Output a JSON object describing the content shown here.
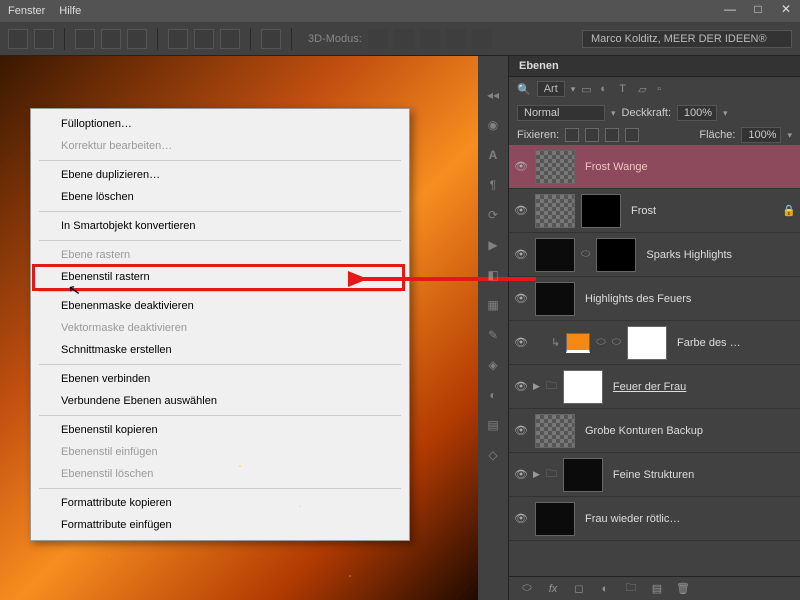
{
  "menubar": {
    "items": [
      "Fenster",
      "Hilfe"
    ]
  },
  "toolbar": {
    "mode_label": "3D-Modus:",
    "profile": "Marco Kolditz, MEER DER IDEEN®"
  },
  "context_menu": {
    "items": [
      {
        "label": "Fülloptionen…",
        "disabled": false
      },
      {
        "label": "Korrektur bearbeiten…",
        "disabled": true
      },
      {
        "sep": true
      },
      {
        "label": "Ebene duplizieren…",
        "disabled": false
      },
      {
        "label": "Ebene löschen",
        "disabled": false
      },
      {
        "sep": true
      },
      {
        "label": "In Smartobjekt konvertieren",
        "disabled": false
      },
      {
        "sep": true
      },
      {
        "label": "Ebene rastern",
        "disabled": true
      },
      {
        "label": "Ebenenstil rastern",
        "disabled": false
      },
      {
        "sep": true
      },
      {
        "label": "Ebenenmaske deaktivieren",
        "disabled": false
      },
      {
        "label": "Vektormaske deaktivieren",
        "disabled": true
      },
      {
        "label": "Schnittmaske erstellen",
        "disabled": false
      },
      {
        "sep": true
      },
      {
        "label": "Ebenen verbinden",
        "disabled": false
      },
      {
        "label": "Verbundene Ebenen auswählen",
        "disabled": false
      },
      {
        "sep": true
      },
      {
        "label": "Ebenenstil kopieren",
        "disabled": false
      },
      {
        "label": "Ebenenstil einfügen",
        "disabled": true
      },
      {
        "label": "Ebenenstil löschen",
        "disabled": true
      },
      {
        "sep": true
      },
      {
        "label": "Formattribute kopieren",
        "disabled": false
      },
      {
        "label": "Formattribute einfügen",
        "disabled": false
      }
    ]
  },
  "layers_panel": {
    "tab": "Ebenen",
    "filter": "Art",
    "blend": {
      "mode": "Normal",
      "opacity_label": "Deckkraft:",
      "opacity": "100%",
      "fill_label": "Fläche:",
      "fill": "100%"
    },
    "lock_label": "Fixieren:",
    "layers": [
      {
        "name": "Frost Wange",
        "selected": true
      },
      {
        "name": "Frost",
        "mask": true,
        "locked": true
      },
      {
        "name": "Sparks Highlights",
        "link": true,
        "dark": true,
        "mask": true
      },
      {
        "name": "Highlights des Feuers",
        "dark": true
      },
      {
        "name": "Farbe des …",
        "adj": true,
        "mask_white": true,
        "link": true
      },
      {
        "name": "Feuer der Frau",
        "group": true,
        "underline": true,
        "dark": true,
        "white": true
      },
      {
        "name": "Grobe Konturen Backup"
      },
      {
        "name": "Feine Strukturen",
        "group": true,
        "dark": true,
        "silh": true
      },
      {
        "name": "Frau wieder rötlic…",
        "dark": true,
        "silh2": true
      }
    ]
  }
}
